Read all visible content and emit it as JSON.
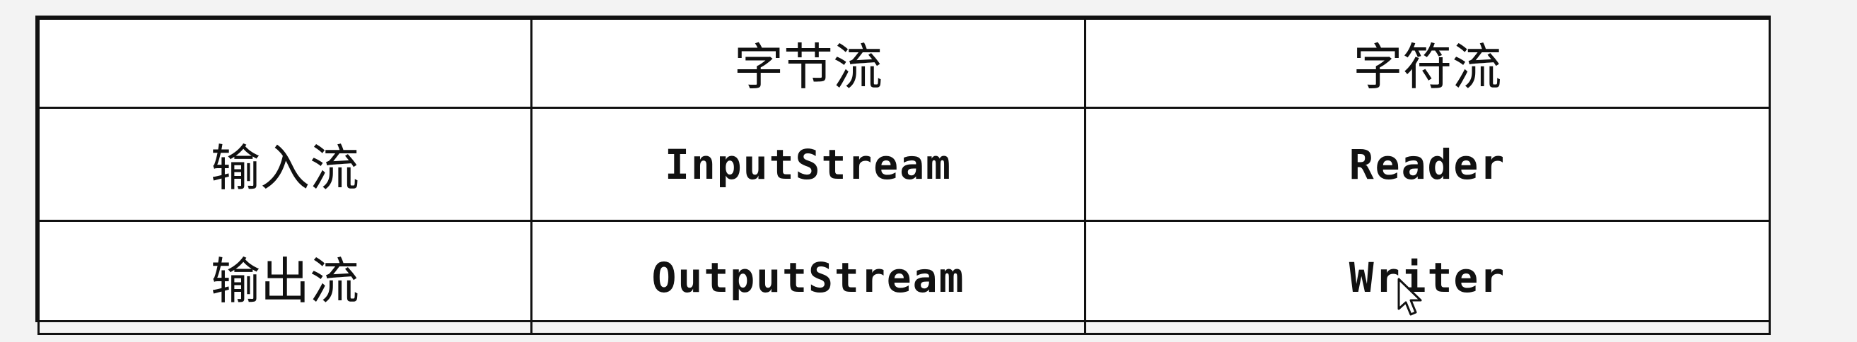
{
  "table": {
    "header": {
      "corner": "",
      "byte_stream": "字节流",
      "char_stream": "字符流"
    },
    "rows": [
      {
        "label": "输入流",
        "byte_stream": "InputStream",
        "char_stream": "Reader"
      },
      {
        "label": "输出流",
        "byte_stream": "OutputStream",
        "char_stream": "Writer"
      }
    ]
  },
  "icons": {
    "cursor": "mouse-pointer-icon"
  }
}
